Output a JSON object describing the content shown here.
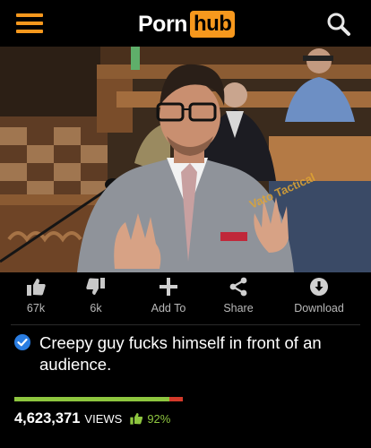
{
  "header": {
    "logo_part1": "Porn",
    "logo_part2": "hub",
    "accent_color": "#f7981d"
  },
  "video": {
    "watermark": "Vato Tactical"
  },
  "actions": [
    {
      "icon": "thumbs-up-icon",
      "label": "67k"
    },
    {
      "icon": "thumbs-down-icon",
      "label": "6k"
    },
    {
      "icon": "plus-icon",
      "label": "Add To"
    },
    {
      "icon": "share-icon",
      "label": "Share"
    },
    {
      "icon": "download-icon",
      "label": "Download"
    }
  ],
  "title": {
    "verified": true,
    "verified_color": "#2a7de1",
    "text": "Creepy guy fucks himself in front of an audience."
  },
  "stats": {
    "views": "4,623,371",
    "views_label": "VIEWS",
    "rating": "92%",
    "rating_fraction": 0.92,
    "positive_color": "#8ec63f",
    "negative_color": "#d43a2a"
  }
}
